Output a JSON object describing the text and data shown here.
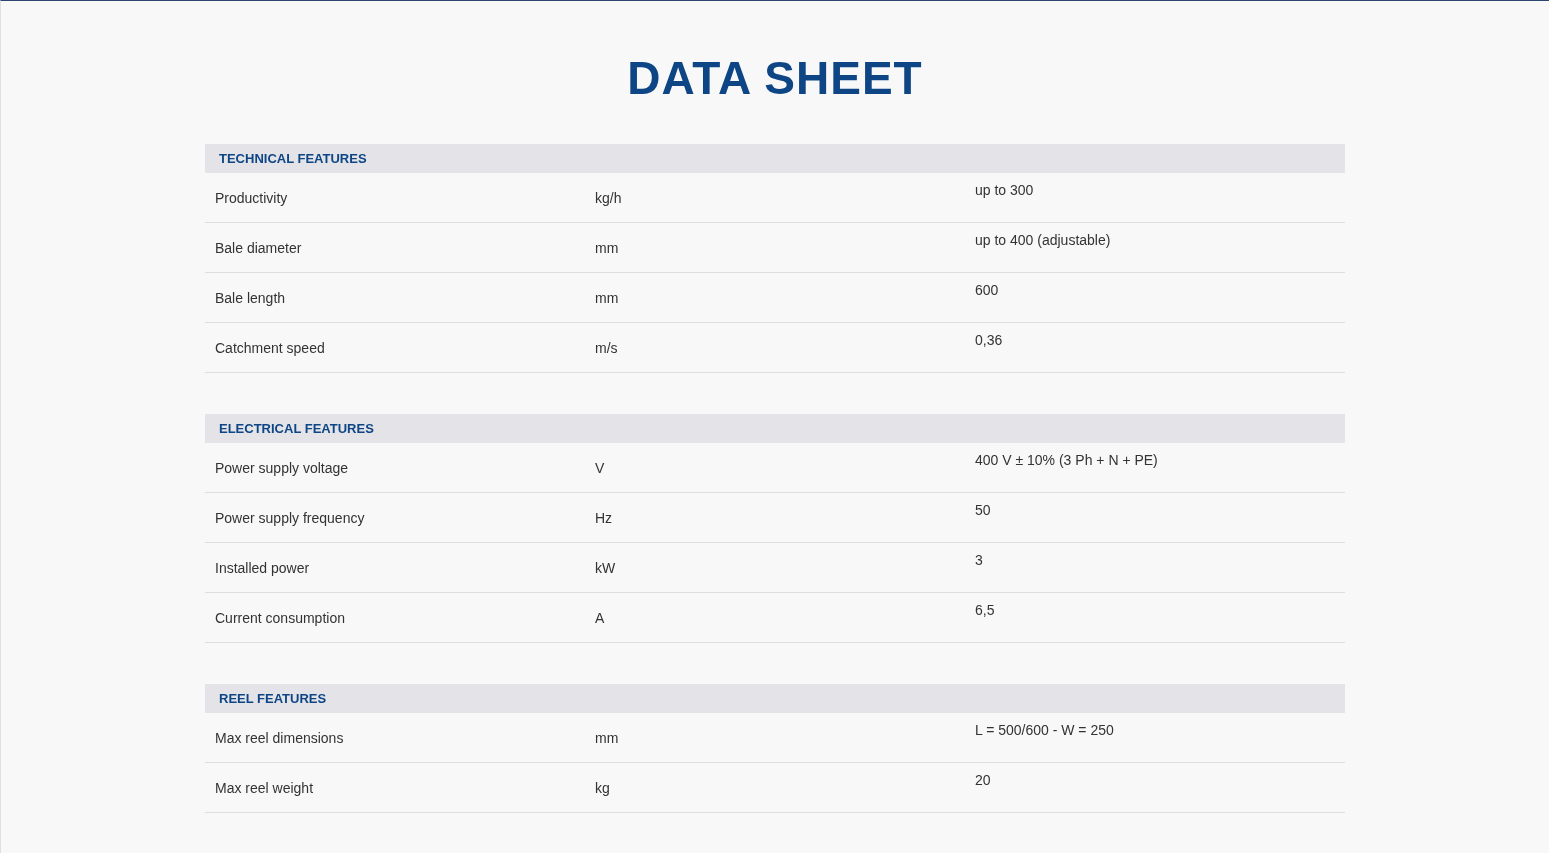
{
  "title": "DATA SHEET",
  "sections": [
    {
      "heading": "TECHNICAL FEATURES",
      "rows": [
        {
          "label": "Productivity",
          "unit": "kg/h",
          "value": "up to 300"
        },
        {
          "label": "Bale diameter",
          "unit": "mm",
          "value": "up to 400 (adjustable)"
        },
        {
          "label": "Bale length",
          "unit": "mm",
          "value": "600"
        },
        {
          "label": "Catchment speed",
          "unit": "m/s",
          "value": "0,36"
        }
      ]
    },
    {
      "heading": "ELECTRICAL FEATURES",
      "rows": [
        {
          "label": "Power supply voltage",
          "unit": "V",
          "value": "400 V ± 10% (3 Ph + N + PE)"
        },
        {
          "label": "Power supply frequency",
          "unit": "Hz",
          "value": "50"
        },
        {
          "label": "Installed power",
          "unit": "kW",
          "value": "3"
        },
        {
          "label": "Current consumption",
          "unit": "A",
          "value": "6,5"
        }
      ]
    },
    {
      "heading": "REEL FEATURES",
      "rows": [
        {
          "label": "Max reel dimensions",
          "unit": "mm",
          "value": "L = 500/600 - W = 250"
        },
        {
          "label": "Max reel weight",
          "unit": "kg",
          "value": "20"
        }
      ]
    }
  ]
}
